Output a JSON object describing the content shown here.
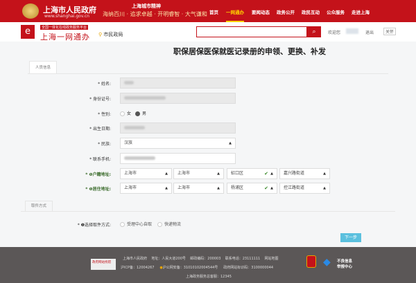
{
  "header": {
    "gov_name": "上海市人民政府",
    "url": "www.shanghai.gov.cn",
    "slogan_title": "上海城市精神",
    "slogan": "海纳百川 · 追求卓越 · 开明睿智 · 大气谦和",
    "nav": [
      "首页",
      "一网通办",
      "要闻动态",
      "政务公开",
      "政民互动",
      "公众服务",
      "走进上海"
    ],
    "nav_active": 1
  },
  "subheader": {
    "badge": "全国一体化在线政务服务平台",
    "brand": "上海一网通办",
    "location": "市民政局",
    "welcome": "欢迎您",
    "logout": "退出",
    "elder": "关怀"
  },
  "page_title": "职保居保医保就医记录册的申领、更换、补发",
  "tabs": {
    "person": "人员信息",
    "pickup": "取件方式"
  },
  "form": {
    "name_label": "* 姓名:",
    "id_label": "* 身份证号:",
    "gender_label": "* 性别:",
    "gender_female": "女",
    "gender_male": "男",
    "birth_label": "* 出生日期:",
    "ethnic_label": "* 民族:",
    "ethnic_value": "汉族",
    "phone_label": "* 联系手机:",
    "huji_label": "* ❶户籍地址:",
    "huji": [
      "上海市",
      "上海市",
      "虹口区",
      "嘉兴路街道"
    ],
    "live_label": "* ❶居住地址:",
    "live": [
      "上海市",
      "上海市",
      "杨浦区",
      "控江路街道"
    ],
    "pickup_label": "* ❶选择取件方式:",
    "pickup_options": [
      "受理中心自取",
      "快递物流"
    ],
    "next": "下一步"
  },
  "footer": {
    "line1": [
      "上海市人民政府",
      "地址：人民大道200号",
      "邮政编码：200003",
      "联系电话：23111111",
      "网站地图"
    ],
    "icp": "沪ICP备：12004267",
    "police": "沪公网安备：31010102004544号",
    "site_code": "政府网站标识码：3100000044",
    "service": "上海政务服务总客服：12345",
    "badge1": "政府网站找错",
    "report": "不良信息举报中心"
  }
}
